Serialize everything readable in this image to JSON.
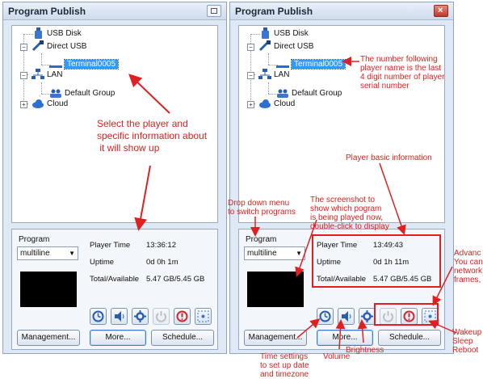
{
  "window_title": "Program Publish",
  "tree": {
    "usb_disk": "USB Disk",
    "direct_usb": "Direct USB",
    "terminal": "Terminal0005",
    "lan": "LAN",
    "default_group": "Default Group",
    "cloud": "Cloud"
  },
  "program": {
    "label": "Program",
    "selected": "multiline"
  },
  "info_labels": {
    "player_time": "Player Time",
    "uptime": "Uptime",
    "total": "Total/Available"
  },
  "left_info": {
    "player_time": "13:36:12",
    "uptime": "0d 0h 1m",
    "total": "5.47 GB/5.45 GB"
  },
  "right_info": {
    "player_time": "13:49:43",
    "uptime": "0d 1h 11m",
    "total": "5.47 GB/5.45 GB"
  },
  "buttons": {
    "management": "Management...",
    "more": "More...",
    "schedule": "Schedule..."
  },
  "icons": [
    "clock-icon",
    "speaker-icon",
    "gear-icon",
    "power-icon",
    "reboot-icon",
    "advanced-dots-icon"
  ],
  "annotations": {
    "select_player": "Select the player and\nspecific information about\n it will show up",
    "number_following": "The number following\nplayer name is the last\n4 digit number of player\nserial number",
    "basic_info": "Player basic information",
    "drop_down": "Drop down menu\nto switch programs",
    "screenshot": "The screenshot to\nshow which pogram\nis being played now,\ndouble-click to display",
    "advanced": "Advanc\nYou can\nnetwork\nframes, ",
    "time_settings": "Time settings\nto set up date\nand timezone",
    "volume": "Volume",
    "brightness": "Brightness",
    "wakeup": "Wakeup\nSleep\nReboot"
  },
  "colors": {
    "annotation": "#e02020",
    "selection": "#3399ff"
  }
}
